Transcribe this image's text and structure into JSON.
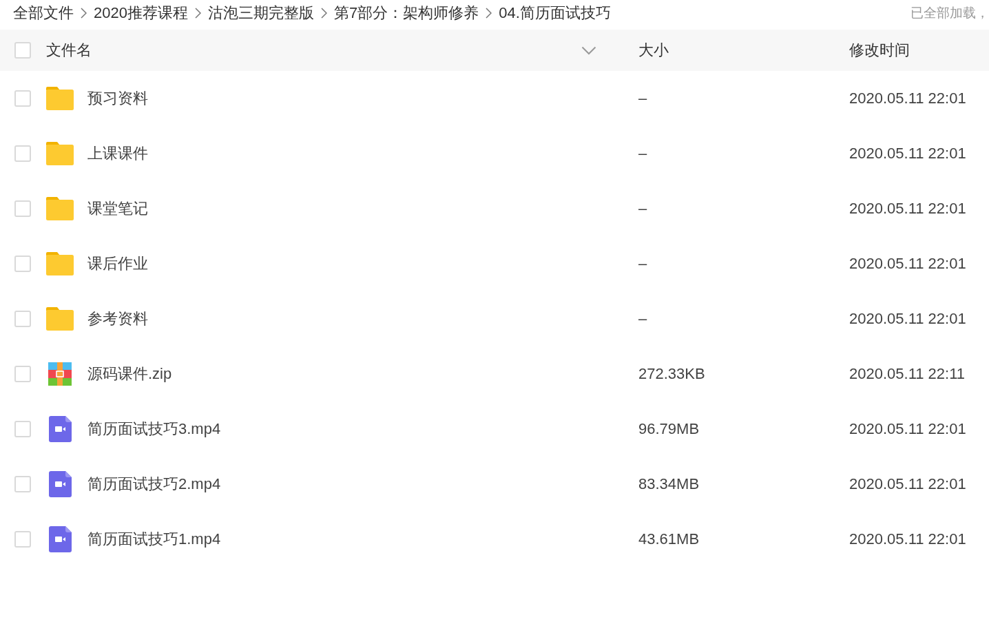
{
  "breadcrumb": [
    "全部文件",
    "2020推荐课程",
    "沽泡三期完整版",
    "第7部分：架构师修养",
    "04.简历面试技巧"
  ],
  "load_status": "已全部加载，",
  "table": {
    "select_all": {
      "checked": false
    },
    "columns": [
      "文件名",
      "大小",
      "修改时间"
    ],
    "rows": [
      {
        "kind": "folder",
        "name": "预习资料",
        "size": "–",
        "modified": "2020.05.11 22:01",
        "checked": false
      },
      {
        "kind": "folder",
        "name": "上课课件",
        "size": "–",
        "modified": "2020.05.11 22:01",
        "checked": false
      },
      {
        "kind": "folder",
        "name": "课堂笔记",
        "size": "–",
        "modified": "2020.05.11 22:01",
        "checked": false
      },
      {
        "kind": "folder",
        "name": "课后作业",
        "size": "–",
        "modified": "2020.05.11 22:01",
        "checked": false
      },
      {
        "kind": "folder",
        "name": "参考资料",
        "size": "–",
        "modified": "2020.05.11 22:01",
        "checked": false
      },
      {
        "kind": "zip",
        "name": "源码课件.zip",
        "size": "272.33KB",
        "modified": "2020.05.11 22:11",
        "checked": false
      },
      {
        "kind": "video",
        "name": "简历面试技巧3.mp4",
        "size": "96.79MB",
        "modified": "2020.05.11 22:01",
        "checked": false
      },
      {
        "kind": "video",
        "name": "简历面试技巧2.mp4",
        "size": "83.34MB",
        "modified": "2020.05.11 22:01",
        "checked": false
      },
      {
        "kind": "video",
        "name": "简历面试技巧1.mp4",
        "size": "43.61MB",
        "modified": "2020.05.11 22:01",
        "checked": false
      }
    ]
  }
}
